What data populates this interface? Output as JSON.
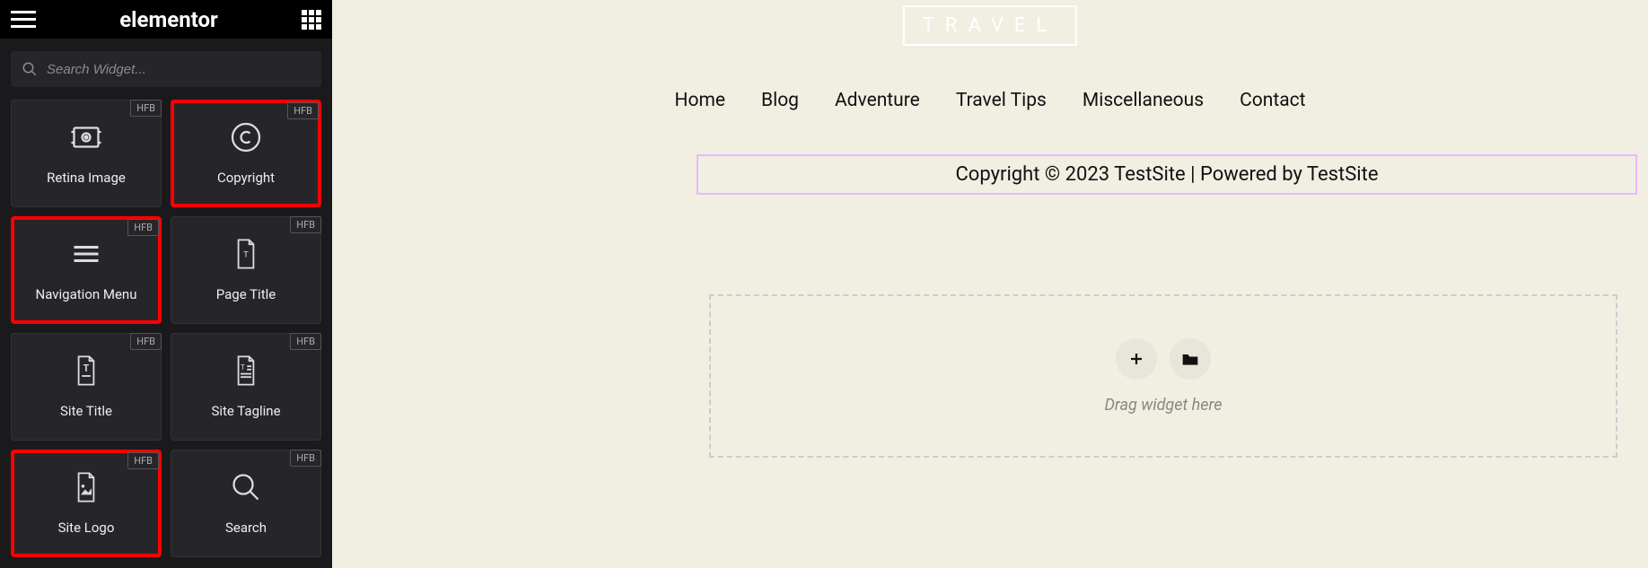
{
  "sidebar": {
    "brand": "elementor",
    "search_placeholder": "Search Widget...",
    "widgets": [
      {
        "label": "Retina Image",
        "badge": "HFB",
        "highlight": false
      },
      {
        "label": "Copyright",
        "badge": "HFB",
        "highlight": true
      },
      {
        "label": "Navigation Menu",
        "badge": "HFB",
        "highlight": true
      },
      {
        "label": "Page Title",
        "badge": "HFB",
        "highlight": false
      },
      {
        "label": "Site Title",
        "badge": "HFB",
        "highlight": false
      },
      {
        "label": "Site Tagline",
        "badge": "HFB",
        "highlight": false
      },
      {
        "label": "Site Logo",
        "badge": "HFB",
        "highlight": true
      },
      {
        "label": "Search",
        "badge": "HFB",
        "highlight": false
      }
    ]
  },
  "preview": {
    "logo_text": "TRAVEL",
    "nav": [
      "Home",
      "Blog",
      "Adventure",
      "Travel Tips",
      "Miscellaneous",
      "Contact"
    ],
    "copyright": "Copyright © 2023 TestSite | Powered by TestSite",
    "dropzone_text": "Drag widget here"
  }
}
